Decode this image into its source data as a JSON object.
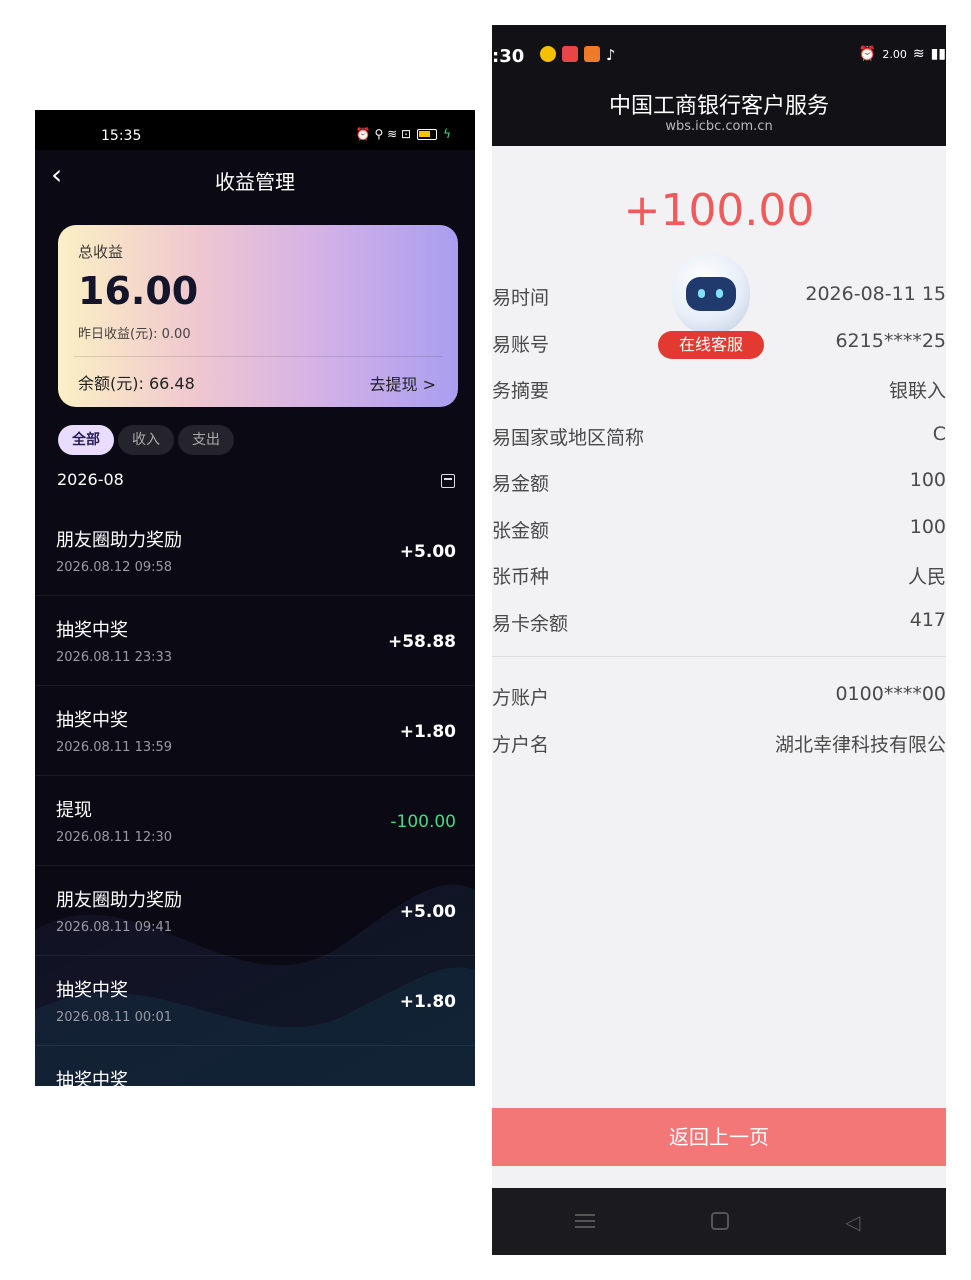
{
  "left": {
    "status_time": "15:35",
    "status_icons": "⏰ ⚲ ≋ ⊡",
    "nav_title": "收益管理",
    "card": {
      "total_label": "总收益",
      "total_value": "16.00",
      "yesterday": "昨日收益(元): 0.00",
      "balance": "余额(元): 66.48",
      "withdraw": "去提现 >"
    },
    "filters": [
      "全部",
      "收入",
      "支出"
    ],
    "month": "2026-08",
    "records": [
      {
        "name": "朋友圈助力奖励",
        "date": "2026.08.12 09:58",
        "amount": "+5.00"
      },
      {
        "name": "抽奖中奖",
        "date": "2026.08.11 23:33",
        "amount": "+58.88"
      },
      {
        "name": "抽奖中奖",
        "date": "2026.08.11 13:59",
        "amount": "+1.80"
      },
      {
        "name": "提现",
        "date": "2026.08.11 12:30",
        "amount": "-100.00"
      },
      {
        "name": "朋友圈助力奖励",
        "date": "2026.08.11 09:41",
        "amount": "+5.00"
      },
      {
        "name": "抽奖中奖",
        "date": "2026.08.11 00:01",
        "amount": "+1.80"
      },
      {
        "name": "抽奖中奖",
        "date": "",
        "amount": ""
      }
    ]
  },
  "right": {
    "status_time": ":30",
    "status_speed": "2.00",
    "title": "中国工商银行客户服务",
    "domain": "wbs.icbc.com.cn",
    "amount": "+100.00",
    "bot_label": "在线客服",
    "details": [
      {
        "k": "易时间",
        "v": "2026-08-11 15"
      },
      {
        "k": "易账号",
        "v": "6215****25"
      },
      {
        "k": "务摘要",
        "v": "银联入"
      },
      {
        "k": "易国家或地区简称",
        "v": "C"
      },
      {
        "k": "易金额",
        "v": "100"
      },
      {
        "k": "张金额",
        "v": "100"
      },
      {
        "k": "张币种",
        "v": "人民"
      },
      {
        "k": "易卡余额",
        "v": "417"
      },
      {
        "k": "方账户",
        "v": "0100****00"
      },
      {
        "k": "方户名",
        "v": "湖北幸律科技有限公"
      }
    ],
    "back_button": "返回上一页",
    "colors": {
      "accent": "#f05a5a",
      "button": "#f47777",
      "income_negative": "#3ddc84"
    }
  }
}
